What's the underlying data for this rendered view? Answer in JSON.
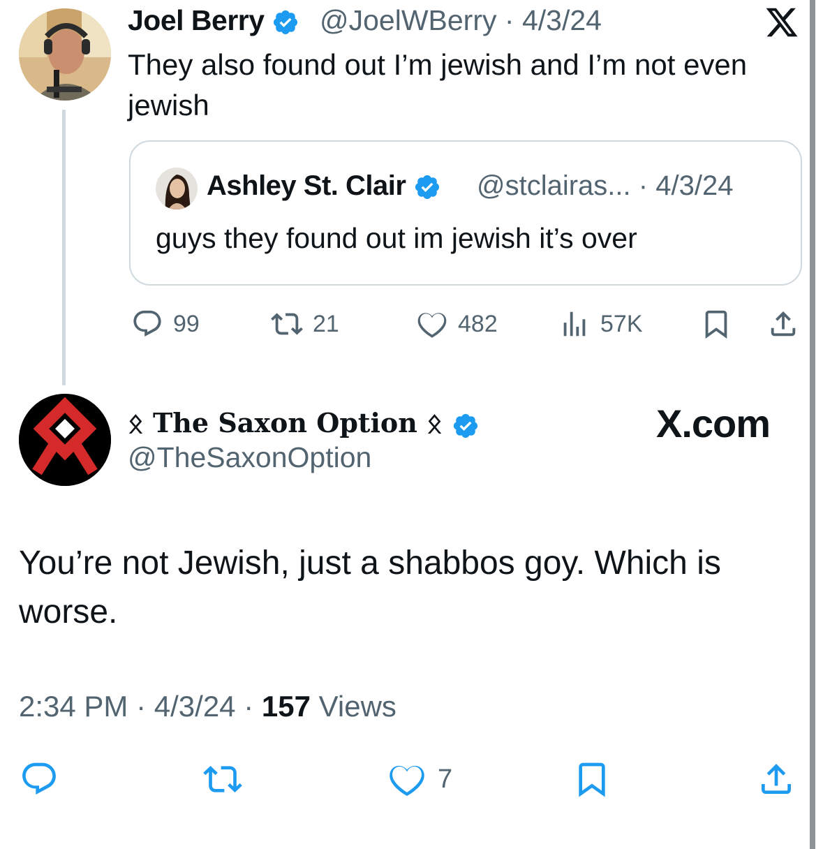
{
  "original_tweet": {
    "author_name": "Joel Berry",
    "handle": "@JoelWBerry",
    "date": "4/3/24",
    "text": "They also found out I’m jewish and I’m not even jewish",
    "quoted": {
      "author_name": "Ashley St. Clair",
      "handle": "@stclairas...",
      "date": "4/3/24",
      "text": "guys they found out im jewish it’s over"
    },
    "actions": {
      "replies": "99",
      "reposts": "21",
      "likes": "482",
      "views": "57K"
    }
  },
  "reply_tweet": {
    "author_name": "ᛟ The Saxon Option ᛟ",
    "handle": "@TheSaxonOption",
    "text": "You’re not Jewish, just a shabbos goy. Which is worse.",
    "time": "2:34 PM",
    "date": "4/3/24",
    "views_count": "157",
    "views_label": "Views",
    "likes": "7"
  },
  "watermark": "X.com",
  "colors": {
    "verified": "#1d9bf0",
    "secondary_text": "#536471",
    "border": "#cfd9de",
    "avatar_accent": "#d42a2a"
  },
  "icons": [
    "x-logo-icon",
    "verified-badge-icon",
    "reply-icon",
    "repost-icon",
    "like-icon",
    "views-icon",
    "bookmark-icon",
    "share-icon"
  ]
}
